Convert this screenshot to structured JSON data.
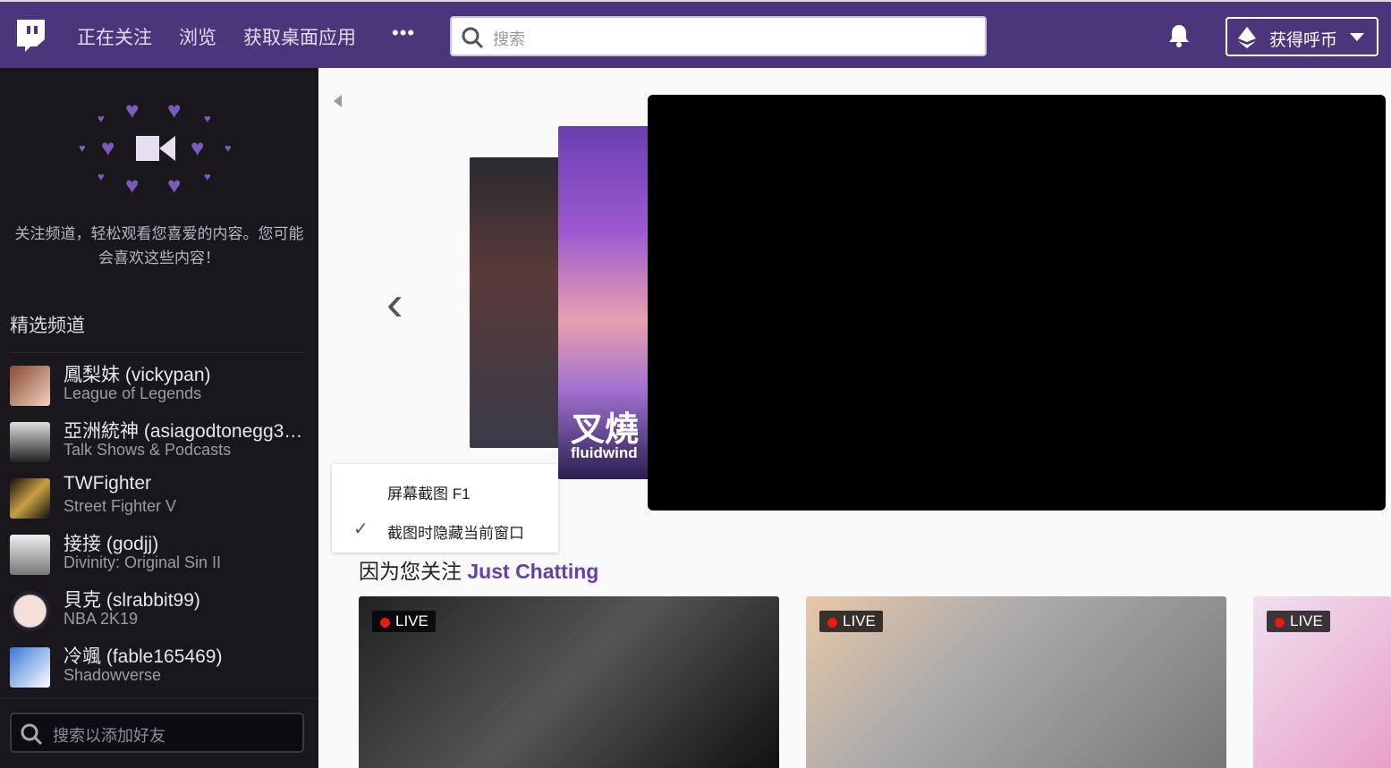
{
  "header": {
    "nav": [
      "正在关注",
      "浏览",
      "获取桌面应用"
    ],
    "more": "•••",
    "search_placeholder": "搜索",
    "coins_label": "获得呼币"
  },
  "sidebar": {
    "promo": "关注频道，轻松观看您喜爱的内容。您可能会喜欢这些内容！",
    "featured_title": "精选频道",
    "channels": [
      {
        "name": "鳳梨妹 (vickypan)",
        "game": "League of Legends"
      },
      {
        "name": "亞洲統神 (asiagodtonegg3…",
        "game": "Talk Shows & Podcasts"
      },
      {
        "name": "TWFighter",
        "game": "Street Fighter V"
      },
      {
        "name": "接接 (godjj)",
        "game": "Divinity: Original Sin II"
      },
      {
        "name": "貝克 (slrabbit99)",
        "game": "NBA 2K19"
      },
      {
        "name": "冷颯 (fable165469)",
        "game": "Shadowverse"
      }
    ],
    "friend_search_placeholder": "搜索以添加好友"
  },
  "carousel": {
    "card2_title": "叉燒",
    "card2_sub": "fluidwind"
  },
  "context_menu": {
    "items": [
      "屏幕截图 F1",
      "截图时隐藏当前窗口"
    ]
  },
  "section": {
    "prefix": "因为您关注",
    "category": "Just Chatting"
  },
  "live_label": "LIVE"
}
